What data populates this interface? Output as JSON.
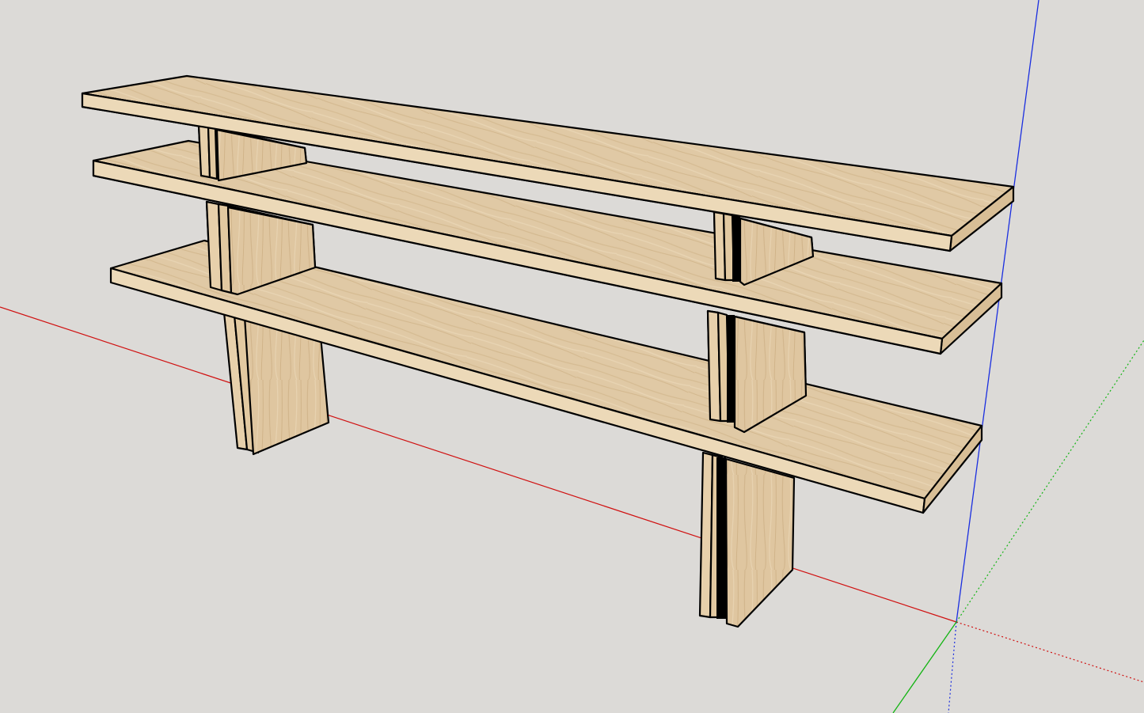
{
  "scene": {
    "background_color": "#dcdad7",
    "axes": {
      "red": "#d01010",
      "green": "#14b414",
      "blue": "#1a2ee0"
    },
    "materials": {
      "wood_top": "#e0c9a5",
      "wood_front": "#ecd9b8",
      "wood_side": "#d8be96",
      "slot": "#000000",
      "edge": "#000000"
    }
  }
}
